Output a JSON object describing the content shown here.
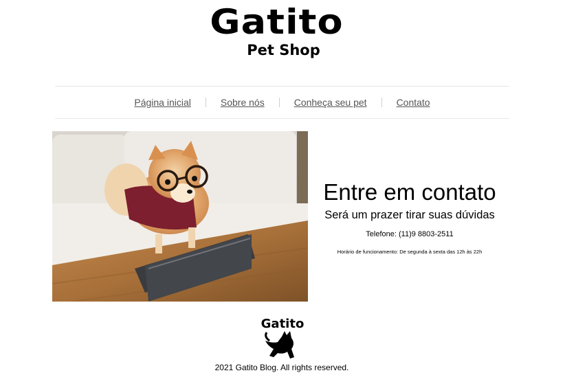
{
  "header": {
    "logo_title": "Gatito",
    "logo_subtitle": "Pet Shop"
  },
  "nav": {
    "items": [
      {
        "label": "Página inicial"
      },
      {
        "label": "Sobre nós"
      },
      {
        "label": "Conheça seu pet"
      },
      {
        "label": "Contato"
      }
    ]
  },
  "hero": {
    "image": "pomeranian-dog-with-glasses-and-tablet-photo"
  },
  "contact": {
    "title": "Entre em contato",
    "subtitle": "Será um prazer tirar suas dúvidas",
    "phone": "Telefone: (11)9 8803-2511",
    "hours": "Horário de funcionamento: De segunda à sexta das 12h às 22h"
  },
  "footer": {
    "logo_text": "Gatito",
    "copyright": "2021 Gatito Blog. All rights reserved."
  }
}
